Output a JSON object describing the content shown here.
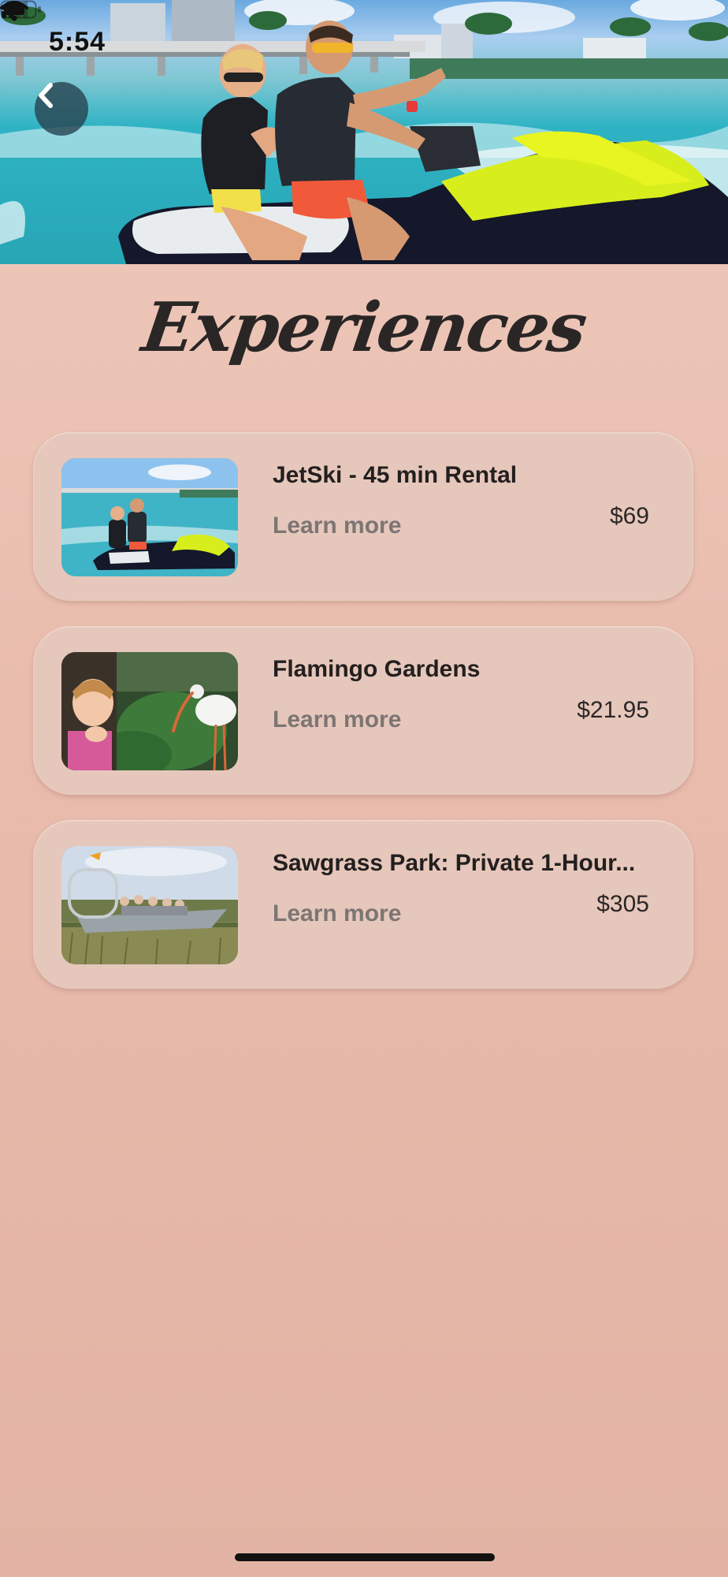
{
  "status_bar": {
    "time": "5:54",
    "location_icon": "location-arrow-icon",
    "signal_icon": "signal-icon",
    "wifi_icon": "wifi-icon",
    "battery_icon": "battery-icon"
  },
  "header": {
    "back_icon": "chevron-left-icon",
    "hero_image": "jetski-couple-photo"
  },
  "page": {
    "title": "Experiences"
  },
  "experiences": [
    {
      "title": "JetSki - 45 min Rental",
      "link": "Learn more",
      "price": "$69",
      "image": "jetski-thumbnail"
    },
    {
      "title": "Flamingo Gardens",
      "link": "Learn more",
      "price": "$21.95",
      "image": "ibis-and-child-thumbnail"
    },
    {
      "title": "Sawgrass Park: Private 1-Hour...",
      "link": "Learn more",
      "price": "$305",
      "image": "airboat-thumbnail"
    }
  ],
  "colors": {
    "background_top": "#eecbbd",
    "background_bottom": "#e2b3a4",
    "card": "#e6c7bb",
    "title_text": "#231f1f",
    "link_text": "#7c7573",
    "back_button": "#284652"
  }
}
